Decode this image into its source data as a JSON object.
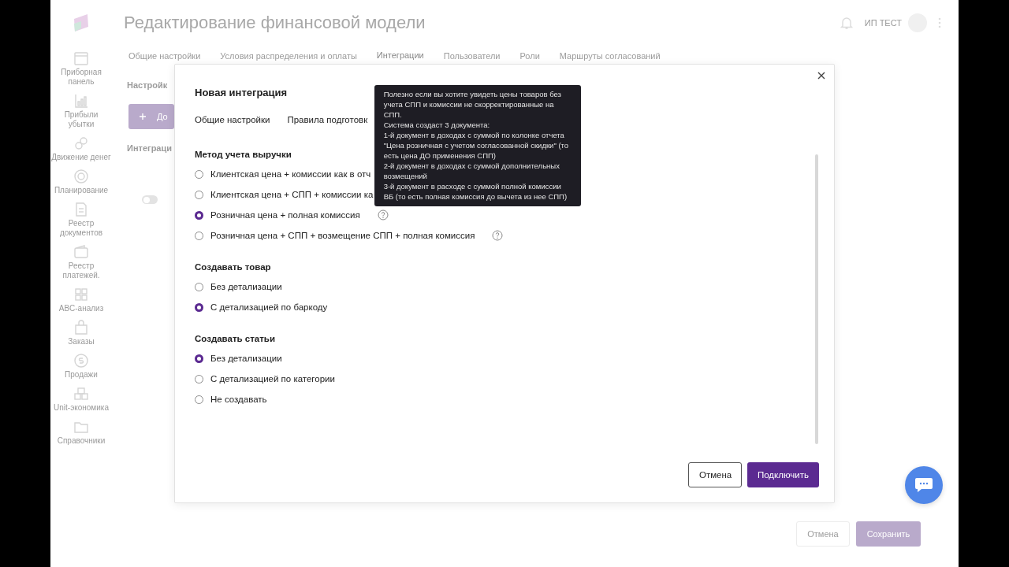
{
  "app": {
    "title": "Редактирование финансовой модели",
    "user": "ИП ТЕСТ",
    "sidebar": [
      {
        "label": "Приборная панель"
      },
      {
        "label": "Прибыли убытки"
      },
      {
        "label": "Движение денег"
      },
      {
        "label": "Планирование"
      },
      {
        "label": "Реестр документов"
      },
      {
        "label": "Реестр платежей."
      },
      {
        "label": "ABC-анализ"
      },
      {
        "label": "Заказы"
      },
      {
        "label": "Продажи"
      },
      {
        "label": "Unit-экономика"
      },
      {
        "label": "Справочники"
      }
    ],
    "tabs": [
      {
        "label": "Общие настройки",
        "selected": false
      },
      {
        "label": "Условия распределения и оплаты",
        "selected": false
      },
      {
        "label": "Интеграции",
        "selected": true
      },
      {
        "label": "Пользователи",
        "selected": false
      },
      {
        "label": "Роли",
        "selected": false
      },
      {
        "label": "Маршруты согласований",
        "selected": false
      }
    ],
    "section_title": "Настройк",
    "add_button": "До",
    "integrations_title": "Интеграци",
    "toggle": {
      "on": false
    },
    "footer_buttons": [
      {
        "label": "Отмена",
        "kind": "secondary"
      },
      {
        "label": "Сохранить",
        "kind": "primary"
      }
    ]
  },
  "modal": {
    "title": "Новая интеграция",
    "tabs": [
      {
        "label": "Общие настройки",
        "selected": false
      },
      {
        "label": "Правила подготовк",
        "selected": false
      }
    ],
    "groups": [
      {
        "title": "Метод учета выручки",
        "options": [
          {
            "label": "Клиентская цена + комиссии как в отч",
            "selected": false,
            "help": false
          },
          {
            "label": "Клиентская цена + СПП + комиссии ка",
            "selected": false,
            "help": false
          },
          {
            "label": "Розничная цена + полная комиссия",
            "selected": true,
            "help": true,
            "tooltip": [
              "Полезно если вы хотите увидеть цены товаров без учета СПП и комиссии не скорректированные на СПП.",
              "Система создаст 3 документа:",
              "1-й документ в доходах с суммой по колонке отчета \"Цена розничная с учетом согласованной скидки\" (то есть цена ДО применения СПП)",
              "2-й документ в доходах с суммой дополнительных возмещений",
              "3-й документ в расходе с суммой полной комиссии ВБ (то есть полная комиссия до вычета из нее СПП)"
            ]
          },
          {
            "label": "Розничная цена + СПП + возмещение СПП + полная комиссия",
            "selected": false,
            "help": true
          }
        ]
      },
      {
        "title": "Создавать товар",
        "options": [
          {
            "label": "Без детализации",
            "selected": false,
            "help": false
          },
          {
            "label": "С детализацией по баркоду",
            "selected": true,
            "help": false
          }
        ]
      },
      {
        "title": "Создавать статьи",
        "options": [
          {
            "label": "Без детализации",
            "selected": true,
            "help": false
          },
          {
            "label": "С детализацией по категории",
            "selected": false,
            "help": false
          },
          {
            "label": "Не создавать",
            "selected": false,
            "help": false
          }
        ]
      }
    ],
    "buttons": [
      {
        "label": "Отмена",
        "kind": "secondary"
      },
      {
        "label": "Подключить",
        "kind": "primary"
      }
    ]
  }
}
